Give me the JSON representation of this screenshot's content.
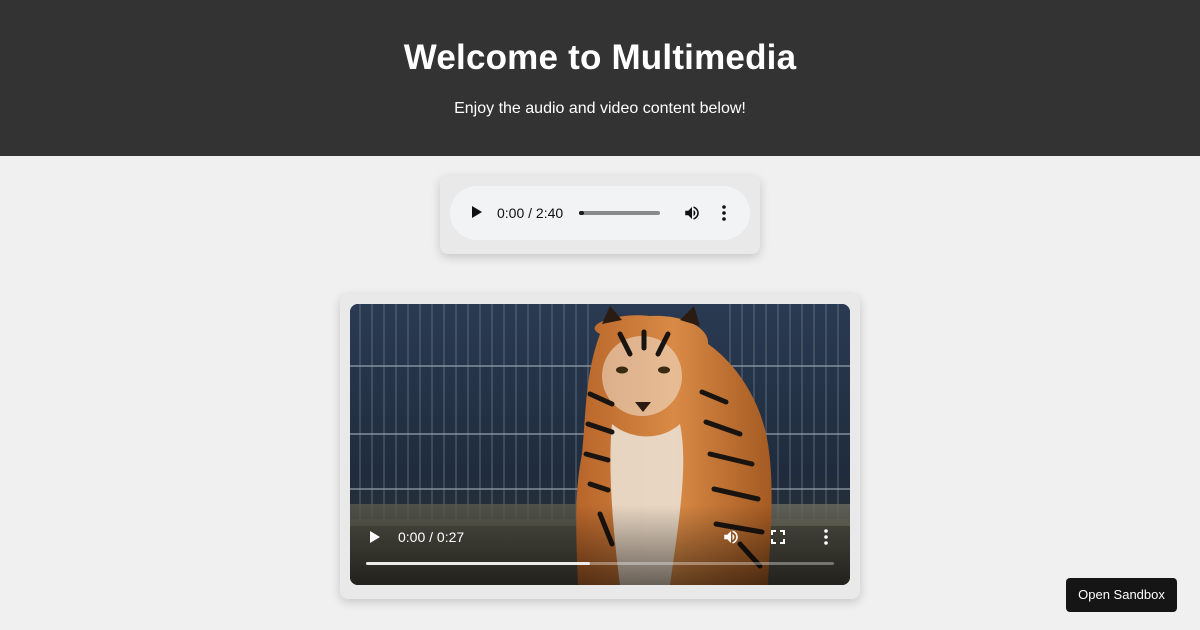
{
  "header": {
    "title": "Welcome to Multimedia",
    "subtitle": "Enjoy the audio and video content below!",
    "background": "#333333"
  },
  "audio": {
    "time_display": "0:00 / 2:40",
    "progress_fraction": 0.0,
    "icons": [
      "play-icon",
      "volume-icon",
      "more-options-icon"
    ]
  },
  "video": {
    "time_display": "0:00 / 0:27",
    "buffered_fraction": 0.478,
    "subject": "tiger",
    "icons": [
      "play-icon",
      "volume-icon",
      "fullscreen-icon",
      "more-options-icon"
    ]
  },
  "sandbox_button": {
    "label": "Open Sandbox"
  }
}
